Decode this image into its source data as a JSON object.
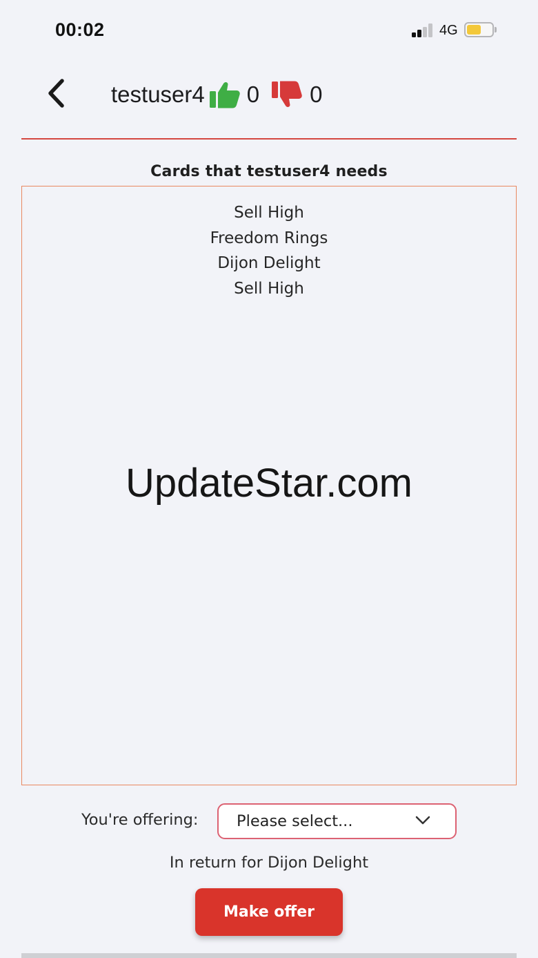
{
  "status_bar": {
    "time": "00:02",
    "network": "4G",
    "signal_bars_filled": 2,
    "signal_bars_total": 4,
    "battery_level": 0.5,
    "battery_color": "#f3c83a"
  },
  "header": {
    "username": "testuser4",
    "thumbs_up_count": "0",
    "thumbs_down_count": "0",
    "thumbs_up_color": "#3fae45",
    "thumbs_down_color": "#d63a3a"
  },
  "needs": {
    "title": "Cards that testuser4 needs",
    "cards": [
      "Sell High",
      "Freedom Rings",
      "Dijon Delight",
      "Sell High"
    ]
  },
  "watermark": "UpdateStar.com",
  "offer": {
    "label": "You're offering:",
    "select_value": "Please select...",
    "return_text": "In return for Dijon Delight",
    "button_label": "Make offer",
    "accent_color": "#d9342b"
  }
}
